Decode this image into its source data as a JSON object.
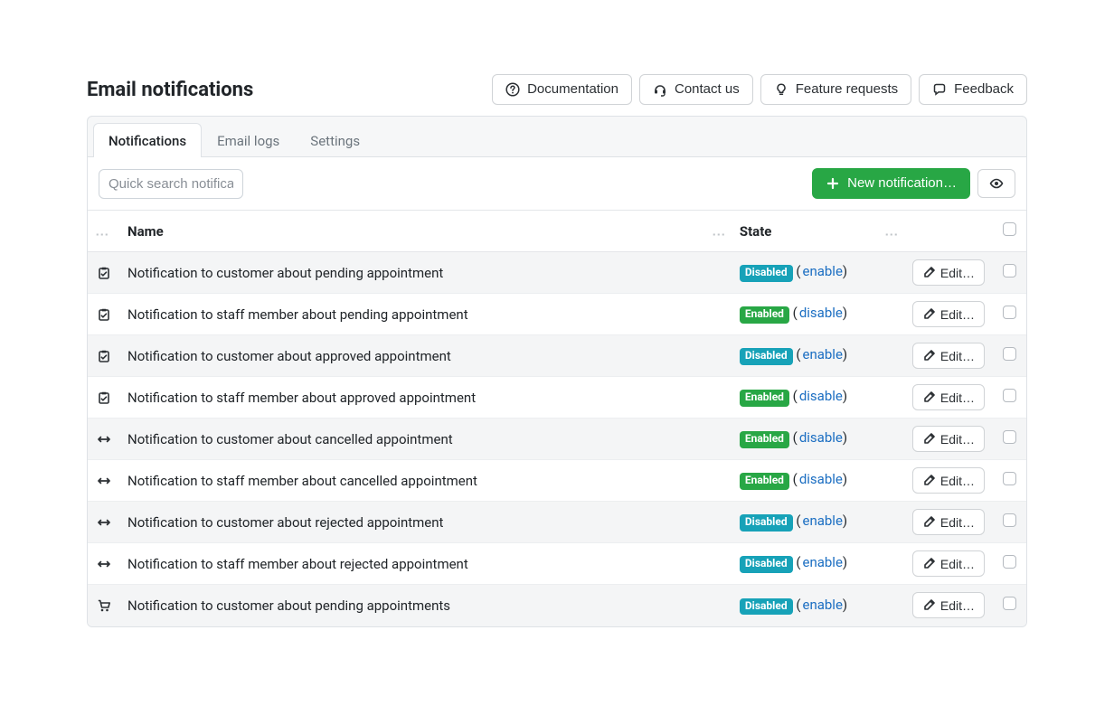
{
  "page": {
    "title": "Email notifications"
  },
  "header_buttons": {
    "documentation": "Documentation",
    "contact_us": "Contact us",
    "feature_requests": "Feature requests",
    "feedback": "Feedback"
  },
  "tabs": {
    "notifications": "Notifications",
    "email_logs": "Email logs",
    "settings": "Settings"
  },
  "toolbar": {
    "search_placeholder": "Quick search notification",
    "new_notification": "New notification…"
  },
  "columns": {
    "name": "Name",
    "state": "State"
  },
  "state_labels": {
    "enabled_badge": "Enabled",
    "disabled_badge": "Disabled",
    "enable_link": "enable",
    "disable_link": "disable"
  },
  "actions": {
    "edit": "Edit…"
  },
  "rows": [
    {
      "icon": "clipboard",
      "name": "Notification to customer about pending appointment",
      "enabled": false
    },
    {
      "icon": "clipboard",
      "name": "Notification to staff member about pending appointment",
      "enabled": true
    },
    {
      "icon": "clipboard",
      "name": "Notification to customer about approved appointment",
      "enabled": false
    },
    {
      "icon": "clipboard",
      "name": "Notification to staff member about approved appointment",
      "enabled": true
    },
    {
      "icon": "arrows",
      "name": "Notification to customer about cancelled appointment",
      "enabled": true
    },
    {
      "icon": "arrows",
      "name": "Notification to staff member about cancelled appointment",
      "enabled": true
    },
    {
      "icon": "arrows",
      "name": "Notification to customer about rejected appointment",
      "enabled": false
    },
    {
      "icon": "arrows",
      "name": "Notification to staff member about rejected appointment",
      "enabled": false
    },
    {
      "icon": "cart",
      "name": "Notification to customer about pending appointments",
      "enabled": false
    }
  ]
}
